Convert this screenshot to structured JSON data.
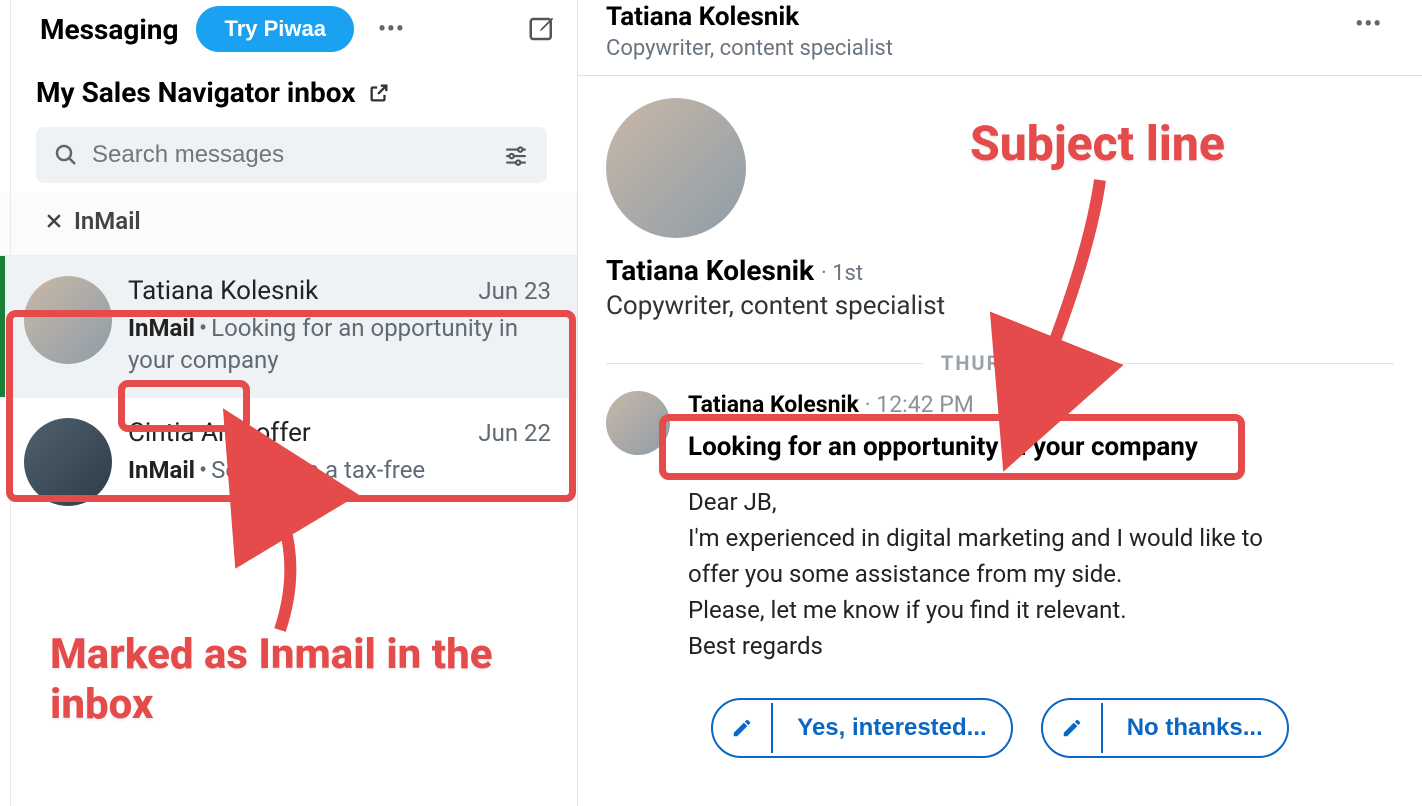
{
  "sidebar": {
    "title": "Messaging",
    "try_label": "Try Piwaa",
    "inbox_link": "My Sales Navigator inbox",
    "search_placeholder": "Search messages",
    "filter_chip": "InMail"
  },
  "threads": [
    {
      "name": "Tatiana Kolesnik",
      "date": "Jun 23",
      "tag": "InMail",
      "preview": "Looking for an opportunity in your company",
      "active": true
    },
    {
      "name": "Cintia Arnhoffer",
      "date": "Jun 22",
      "tag": "InMail",
      "preview": "Setting up a tax-free",
      "active": false
    }
  ],
  "conversation": {
    "header": {
      "name": "Tatiana Kolesnik",
      "role": "Copywriter, content specialist"
    },
    "profile": {
      "name": "Tatiana Kolesnik",
      "degree": "1st",
      "role": "Copywriter, content specialist"
    },
    "day": "THURSDAY",
    "message": {
      "sender": "Tatiana Kolesnik",
      "time": "12:42 PM",
      "subject": "Looking for an opportunity in your company",
      "body": "Dear JB,\nI'm experienced in digital marketing and I would like to offer you some assistance from my side.\nPlease, let me know if you find it relevant.\nBest regards"
    },
    "replies": {
      "yes": "Yes, interested...",
      "no": "No thanks..."
    }
  },
  "annotations": {
    "subject_line": "Subject line",
    "marked_inmail": "Marked as Inmail in the inbox"
  }
}
